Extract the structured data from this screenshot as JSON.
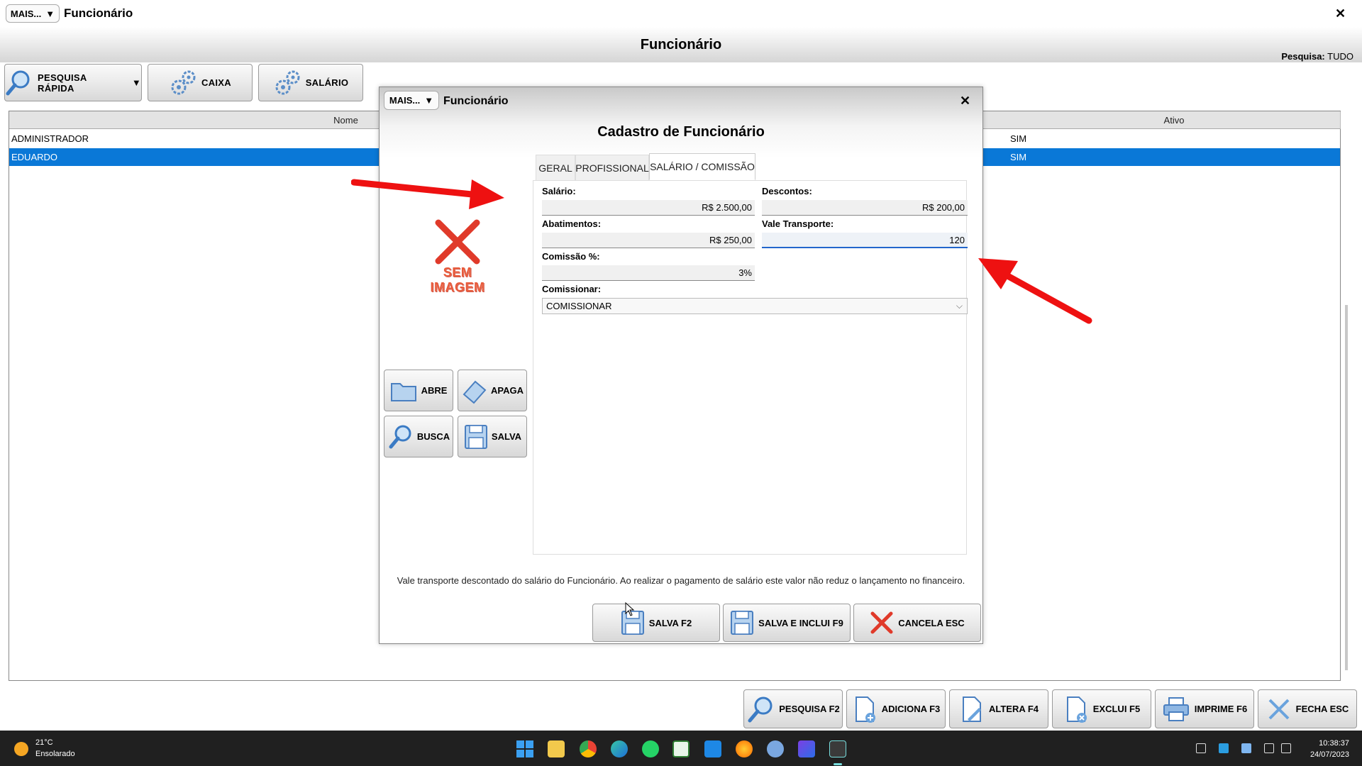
{
  "app": {
    "more_label": "MAIS...",
    "title": "Funcionário",
    "close": "✕",
    "page_title": "Funcionário",
    "search_label": "Pesquisa:",
    "search_value": "TUDO"
  },
  "toolbar": {
    "quick_search": "PESQUISA RÁPIDA",
    "cash": "CAIXA",
    "salary": "SALÁRIO"
  },
  "grid": {
    "columns": [
      "Nome",
      "Ativo"
    ],
    "rows": [
      {
        "nome": "ADMINISTRADOR",
        "ativo": "SIM",
        "selected": false
      },
      {
        "nome": "EDUARDO",
        "ativo": "SIM",
        "selected": true
      }
    ]
  },
  "bottom_buttons": {
    "search": "PESQUISA F2",
    "add": "ADICIONA F3",
    "edit": "ALTERA F4",
    "delete": "EXCLUI F5",
    "print": "IMPRIME F6",
    "close": "FECHA ESC"
  },
  "modal": {
    "more_label": "MAIS...",
    "title": "Funcionário",
    "close": "✕",
    "heading": "Cadastro de Funcionário",
    "no_image_line1": "SEM",
    "no_image_line2": "IMAGEM",
    "image_buttons": {
      "open": "ABRE",
      "erase": "APAGA",
      "find": "BUSCA",
      "save": "SALVA"
    },
    "tabs": [
      "GERAL",
      "PROFISSIONAL",
      "SALÁRIO / COMISSÃO"
    ],
    "active_tab": 2,
    "fields": {
      "salario_label": "Salário:",
      "salario_value": "R$ 2.500,00",
      "descontos_label": "Descontos:",
      "descontos_value": "R$ 200,00",
      "abatimentos_label": "Abatimentos:",
      "abatimentos_value": "R$ 250,00",
      "vale_label": "Vale Transporte:",
      "vale_value": "120",
      "comissao_label": "Comissão %:",
      "comissao_value": "3%",
      "comissionar_label": "Comissionar:",
      "comissionar_value": "COMISSIONAR"
    },
    "info": "Vale transporte descontado do salário do Funcionário. Ao realizar o pagamento de salário este valor não reduz o lançamento no financeiro.",
    "buttons": {
      "save": "SALVA F2",
      "save_new": "SALVA E INCLUI F9",
      "cancel": "CANCELA ESC"
    }
  },
  "taskbar": {
    "temperature": "21°C",
    "weather": "Ensolarado",
    "time": "10:38:37",
    "date": "24/07/2023"
  },
  "colors": {
    "selection": "#0a78d7",
    "annotation_arrow": "#ee1111",
    "focus_border": "#2266cc"
  }
}
